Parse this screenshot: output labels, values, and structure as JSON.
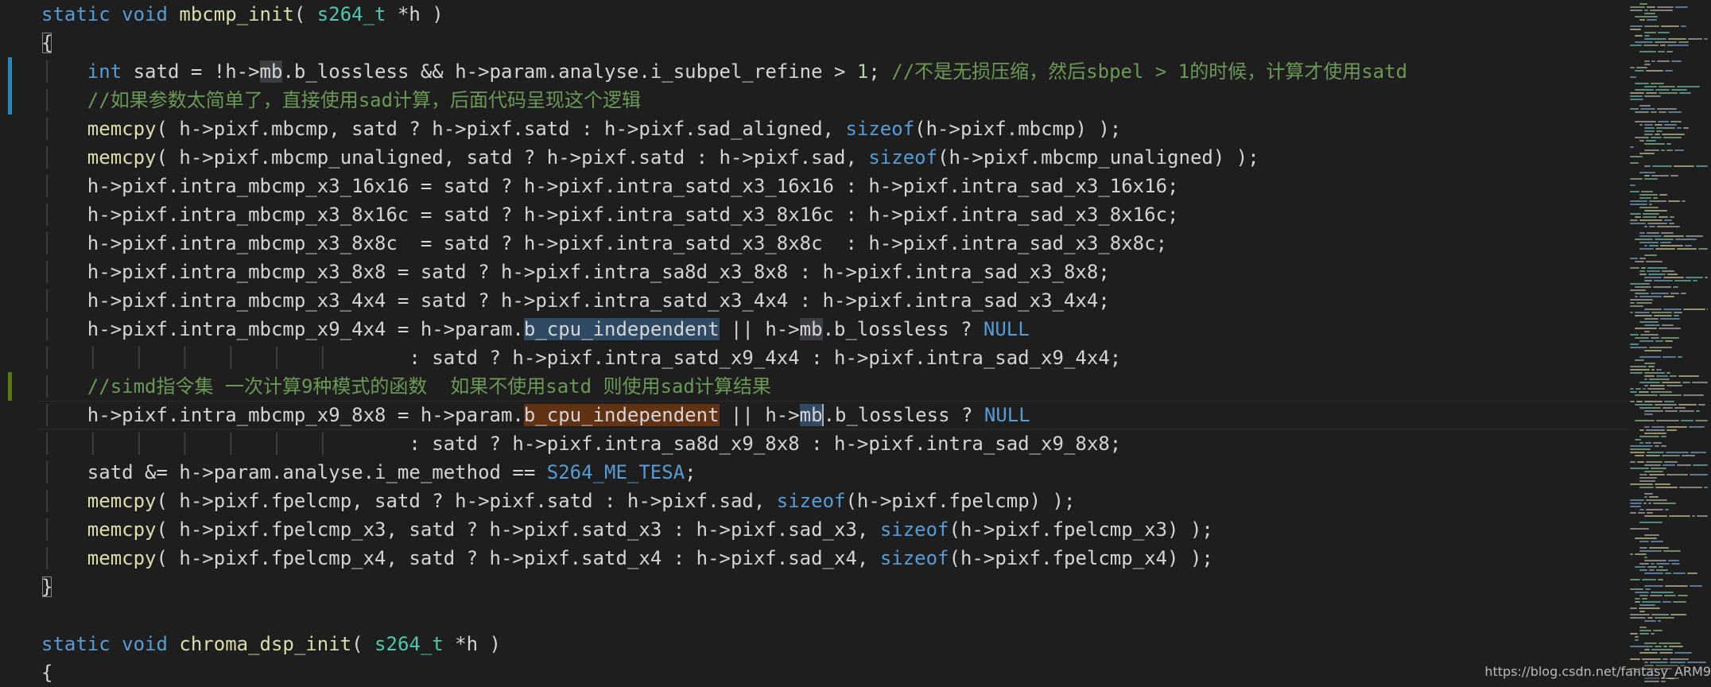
{
  "editor": {
    "colors": {
      "background": "#1e1e1e",
      "keyword": "#569cd6",
      "type": "#4ec9b0",
      "function": "#dcdcaa",
      "comment": "#6a9955",
      "number": "#b5cea8",
      "text": "#d4d4d4",
      "git_modified": "#1f8ab8",
      "git_added": "#587c0c"
    },
    "line1": {
      "kw": "static void ",
      "fn": "mbcmp_init",
      "a": "( ",
      "ty": "s264_t",
      "b": " *h )"
    },
    "line2": {
      "brace": "{"
    },
    "line3": {
      "kw": "int",
      "a": " satd = !h->",
      "sel": "mb",
      "b": ".b_lossless && h->param.analyse.i_subpel_refine > ",
      "num": "1",
      "c": "; ",
      "cm": "//不是无损压缩，然后sbpel > 1的时候，计算才使用satd"
    },
    "line4": {
      "cm": "//如果参数太简单了，直接使用sad计算，后面代码呈现这个逻辑"
    },
    "line5": {
      "fn": "memcpy",
      "a": "( h->pixf.mbcmp, satd ? h->pixf.satd : h->pixf.sad_aligned, ",
      "kw": "sizeof",
      "b": "(h->pixf.mbcmp) );"
    },
    "line6": {
      "fn": "memcpy",
      "a": "( h->pixf.mbcmp_unaligned, satd ? h->pixf.satd : h->pixf.sad, ",
      "kw": "sizeof",
      "b": "(h->pixf.mbcmp_unaligned) );"
    },
    "line7": {
      "a": "h->pixf.intra_mbcmp_x3_16x16 = satd ? h->pixf.intra_satd_x3_16x16 : h->pixf.intra_sad_x3_16x16;"
    },
    "line8": {
      "a": "h->pixf.intra_mbcmp_x3_8x16c = satd ? h->pixf.intra_satd_x3_8x16c : h->pixf.intra_sad_x3_8x16c;"
    },
    "line9": {
      "a": "h->pixf.intra_mbcmp_x3_8x8c  = satd ? h->pixf.intra_satd_x3_8x8c  : h->pixf.intra_sad_x3_8x8c;"
    },
    "line10": {
      "a": "h->pixf.intra_mbcmp_x3_8x8 = satd ? h->pixf.intra_sa8d_x3_8x8 : h->pixf.intra_sad_x3_8x8;"
    },
    "line11": {
      "a": "h->pixf.intra_mbcmp_x3_4x4 = satd ? h->pixf.intra_satd_x3_4x4 : h->pixf.intra_sad_x3_4x4;"
    },
    "line12": {
      "a": "h->pixf.intra_mbcmp_x9_4x4 = h->param.",
      "sel": "b_cpu_independent",
      "b": " || h->",
      "word": "mb",
      "c": ".b_lossless ? ",
      "mac": "NULL"
    },
    "line13": {
      "a": ": satd ? h->pixf.intra_satd_x9_4x4 : h->pixf.intra_sad_x9_4x4;"
    },
    "line14": {
      "cm": "//simd指令集 一次计算9种模式的函数  如果不使用satd 则使用sad计算结果"
    },
    "line15": {
      "a": "h->pixf.intra_mbcmp_x9_8x8 = h->param.",
      "hl": "b_cpu_independent",
      "b": " || h->",
      "cur": "mb",
      "c": ".b_lossless ? ",
      "mac": "NULL"
    },
    "line16": {
      "a": ": satd ? h->pixf.intra_sa8d_x9_8x8 : h->pixf.intra_sad_x9_8x8;"
    },
    "line17": {
      "a": "satd &= h->param.analyse.i_me_method == ",
      "mac": "S264_ME_TESA",
      "b": ";"
    },
    "line18": {
      "fn": "memcpy",
      "a": "( h->pixf.fpelcmp, satd ? h->pixf.satd : h->pixf.sad, ",
      "kw": "sizeof",
      "b": "(h->pixf.fpelcmp) );"
    },
    "line19": {
      "fn": "memcpy",
      "a": "( h->pixf.fpelcmp_x3, satd ? h->pixf.satd_x3 : h->pixf.sad_x3, ",
      "kw": "sizeof",
      "b": "(h->pixf.fpelcmp_x3) );"
    },
    "line20": {
      "fn": "memcpy",
      "a": "( h->pixf.fpelcmp_x4, satd ? h->pixf.satd_x4 : h->pixf.sad_x4, ",
      "kw": "sizeof",
      "b": "(h->pixf.fpelcmp_x4) );"
    },
    "line21": {
      "brace": "}"
    },
    "line22": {},
    "line23": {
      "kw": "static void ",
      "fn": "chroma_dsp_init",
      "a": "( ",
      "ty": "s264_t",
      "b": " *h )"
    },
    "line24": {
      "brace": "{"
    }
  },
  "watermark": "https://blog.csdn.net/fantasy_ARM9"
}
